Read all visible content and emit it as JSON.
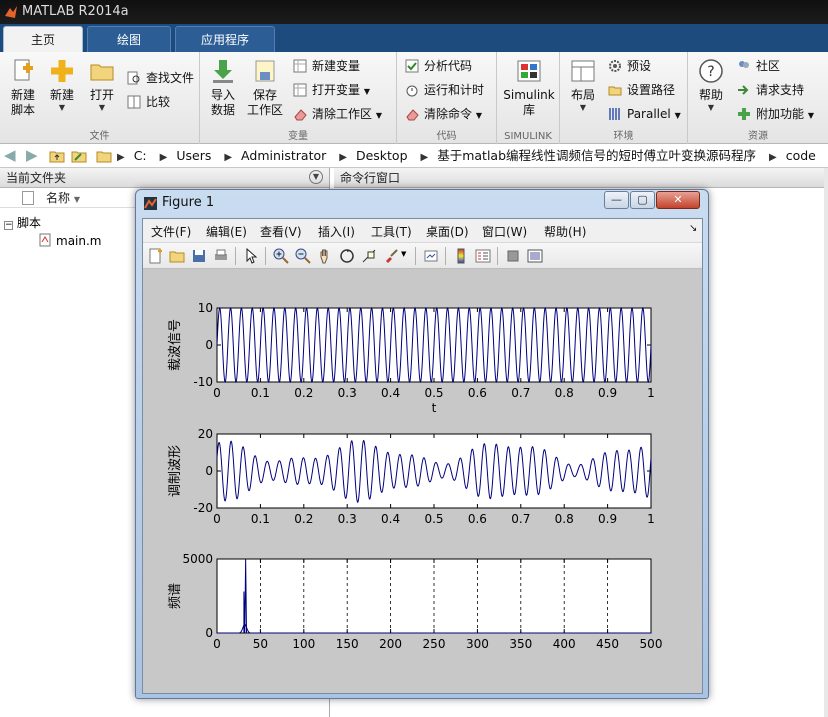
{
  "window": {
    "title": "MATLAB R2014a"
  },
  "ribbon": {
    "tabs": [
      "主页",
      "绘图",
      "应用程序"
    ],
    "file": {
      "label": "文件",
      "new_script": [
        "新建",
        "脚本"
      ],
      "new": "新建",
      "open": "打开",
      "find_files": "查找文件",
      "compare": "比较"
    },
    "variable": {
      "label": "变量",
      "import": [
        "导入",
        "数据"
      ],
      "save": [
        "保存",
        "工作区"
      ],
      "new_var": "新建变量",
      "open_var": "打开变量",
      "clear_ws": "清除工作区"
    },
    "code": {
      "label": "代码",
      "analyze": "分析代码",
      "run_time": "运行和计时",
      "clear_cmds": "清除命令"
    },
    "simulink": {
      "label": "SIMULINK",
      "lib": [
        "Simulink",
        "库"
      ]
    },
    "env": {
      "label": "环境",
      "layout": "布局",
      "prefs": "预设",
      "set_path": "设置路径",
      "parallel": "Parallel"
    },
    "resources": {
      "label": "资源",
      "help": "帮助",
      "community": "社区",
      "request_support": "请求支持",
      "addons": "附加功能"
    }
  },
  "address": {
    "crumbs": [
      "C:",
      "Users",
      "Administrator",
      "Desktop",
      "基于matlab编程线性调频信号的短时傅立叶变换源码程序",
      "code"
    ]
  },
  "left_panel": {
    "title": "当前文件夹",
    "col": "名称",
    "folder": "脚本",
    "file": "main.m"
  },
  "right_panel": {
    "title": "命令行窗口"
  },
  "figure": {
    "title": "Figure 1",
    "menus": [
      "文件(F)",
      "编辑(E)",
      "查看(V)",
      "插入(I)",
      "工具(T)",
      "桌面(D)",
      "窗口(W)",
      "帮助(H)"
    ],
    "win_buttons": {
      "minimize": "—",
      "maximize": "▢",
      "close": "✕"
    }
  },
  "colors": {
    "trace": "#00007f",
    "grid": "#000000"
  },
  "chart_data": [
    {
      "type": "line",
      "xlabel": "t",
      "ylabel": "载波信号",
      "xlim": [
        0,
        1
      ],
      "ylim": [
        -10,
        10
      ],
      "xticks": [
        "0",
        "0.1",
        "0.2",
        "0.3",
        "0.4",
        "0.5",
        "0.6",
        "0.7",
        "0.8",
        "0.9",
        "1"
      ],
      "yticks": [
        "-10",
        "0",
        "10"
      ],
      "series": [
        {
          "desc": "sinusoid",
          "amplitude": 10,
          "cycles": 40
        }
      ]
    },
    {
      "type": "line",
      "xlabel": "",
      "ylabel": "调制波形",
      "xlim": [
        0,
        1
      ],
      "ylim": [
        -20,
        20
      ],
      "xticks": [
        "0",
        "0.1",
        "0.2",
        "0.3",
        "0.4",
        "0.5",
        "0.6",
        "0.7",
        "0.8",
        "0.9",
        "1"
      ],
      "yticks": [
        "-20",
        "0",
        "20"
      ],
      "series": [
        {
          "desc": "modulated",
          "amplitude": 15,
          "cycles": 36
        }
      ]
    },
    {
      "type": "line",
      "xlabel": "",
      "ylabel": "频谱",
      "xlim": [
        0,
        500
      ],
      "ylim": [
        0,
        5000
      ],
      "xticks": [
        "0",
        "50",
        "100",
        "150",
        "200",
        "250",
        "300",
        "350",
        "400",
        "450",
        "500"
      ],
      "yticks": [
        "0",
        "5000"
      ],
      "grid_x": true,
      "series": [
        {
          "peak_x": 33,
          "peak_y": 5000,
          "secondary_peak_x": 31,
          "secondary_peak_y": 2800
        }
      ]
    }
  ]
}
